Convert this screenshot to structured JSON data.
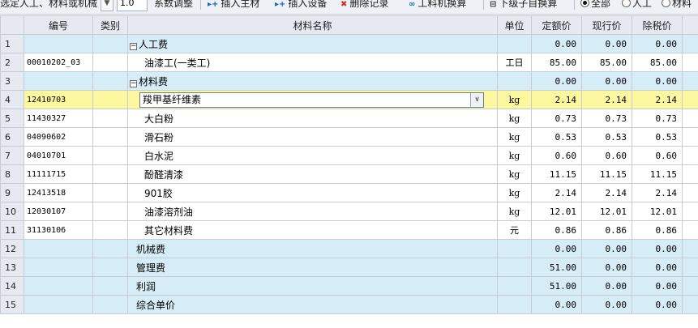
{
  "toolbar": {
    "filter_label": "选定人工、材料或机械",
    "coef_value": "1.0",
    "coef_label": "系数调整",
    "insert_material": "插入主材",
    "insert_equipment": "插入设备",
    "delete_record": "删除记录",
    "convert": "工料机换算",
    "sub_convert": "下级子目换算",
    "radio_all": "全部",
    "radio_labor": "人工",
    "radio_material": "材料"
  },
  "columns": [
    "编号",
    "类别",
    "材料名称",
    "单位",
    "定额价",
    "现行价",
    "除税价"
  ],
  "rows": [
    {
      "n": "1",
      "code": "",
      "type": "",
      "name": "人工费",
      "unit": "",
      "quota": "0.00",
      "current": "0.00",
      "pretax": "0.00"
    },
    {
      "n": "2",
      "code": "00010202_03",
      "type": "",
      "name": "油漆工(一类工)",
      "unit": "工日",
      "quota": "85.00",
      "current": "85.00",
      "pretax": "85.00"
    },
    {
      "n": "3",
      "code": "",
      "type": "",
      "name": "材料费",
      "unit": "",
      "quota": "0.00",
      "current": "0.00",
      "pretax": "0.00"
    },
    {
      "n": "4",
      "code": "12410703",
      "type": "",
      "name": "羧甲基纤维素",
      "unit": "kg",
      "quota": "2.14",
      "current": "2.14",
      "pretax": "2.14"
    },
    {
      "n": "5",
      "code": "11430327",
      "type": "",
      "name": "大白粉",
      "unit": "kg",
      "quota": "0.73",
      "current": "0.73",
      "pretax": "0.73"
    },
    {
      "n": "6",
      "code": "04090602",
      "type": "",
      "name": "滑石粉",
      "unit": "kg",
      "quota": "0.53",
      "current": "0.53",
      "pretax": "0.53"
    },
    {
      "n": "7",
      "code": "04010701",
      "type": "",
      "name": "白水泥",
      "unit": "kg",
      "quota": "0.60",
      "current": "0.60",
      "pretax": "0.60"
    },
    {
      "n": "8",
      "code": "11111715",
      "type": "",
      "name": "酚醛清漆",
      "unit": "kg",
      "quota": "11.15",
      "current": "11.15",
      "pretax": "11.15"
    },
    {
      "n": "9",
      "code": "12413518",
      "type": "",
      "name": "901胶",
      "unit": "kg",
      "quota": "2.14",
      "current": "2.14",
      "pretax": "2.14"
    },
    {
      "n": "10",
      "code": "12030107",
      "type": "",
      "name": "油漆溶剂油",
      "unit": "kg",
      "quota": "12.01",
      "current": "12.01",
      "pretax": "12.01"
    },
    {
      "n": "11",
      "code": "31130106",
      "type": "",
      "name": "其它材料费",
      "unit": "元",
      "quota": "0.86",
      "current": "0.86",
      "pretax": "0.86"
    },
    {
      "n": "12",
      "code": "",
      "type": "",
      "name": "机械费",
      "unit": "",
      "quota": "0.00",
      "current": "0.00",
      "pretax": "0.00"
    },
    {
      "n": "13",
      "code": "",
      "type": "",
      "name": "管理费",
      "unit": "",
      "quota": "51.00",
      "current": "0.00",
      "pretax": "0.00"
    },
    {
      "n": "14",
      "code": "",
      "type": "",
      "name": "利润",
      "unit": "",
      "quota": "51.00",
      "current": "0.00",
      "pretax": "0.00"
    },
    {
      "n": "15",
      "code": "",
      "type": "",
      "name": "综合单价",
      "unit": "",
      "quota": "0.00",
      "current": "0.00",
      "pretax": "0.00"
    }
  ],
  "colors": {
    "group_row": "#d6ecf7",
    "selected_row": "#fdf8a0",
    "header": "#e6eaf0"
  }
}
